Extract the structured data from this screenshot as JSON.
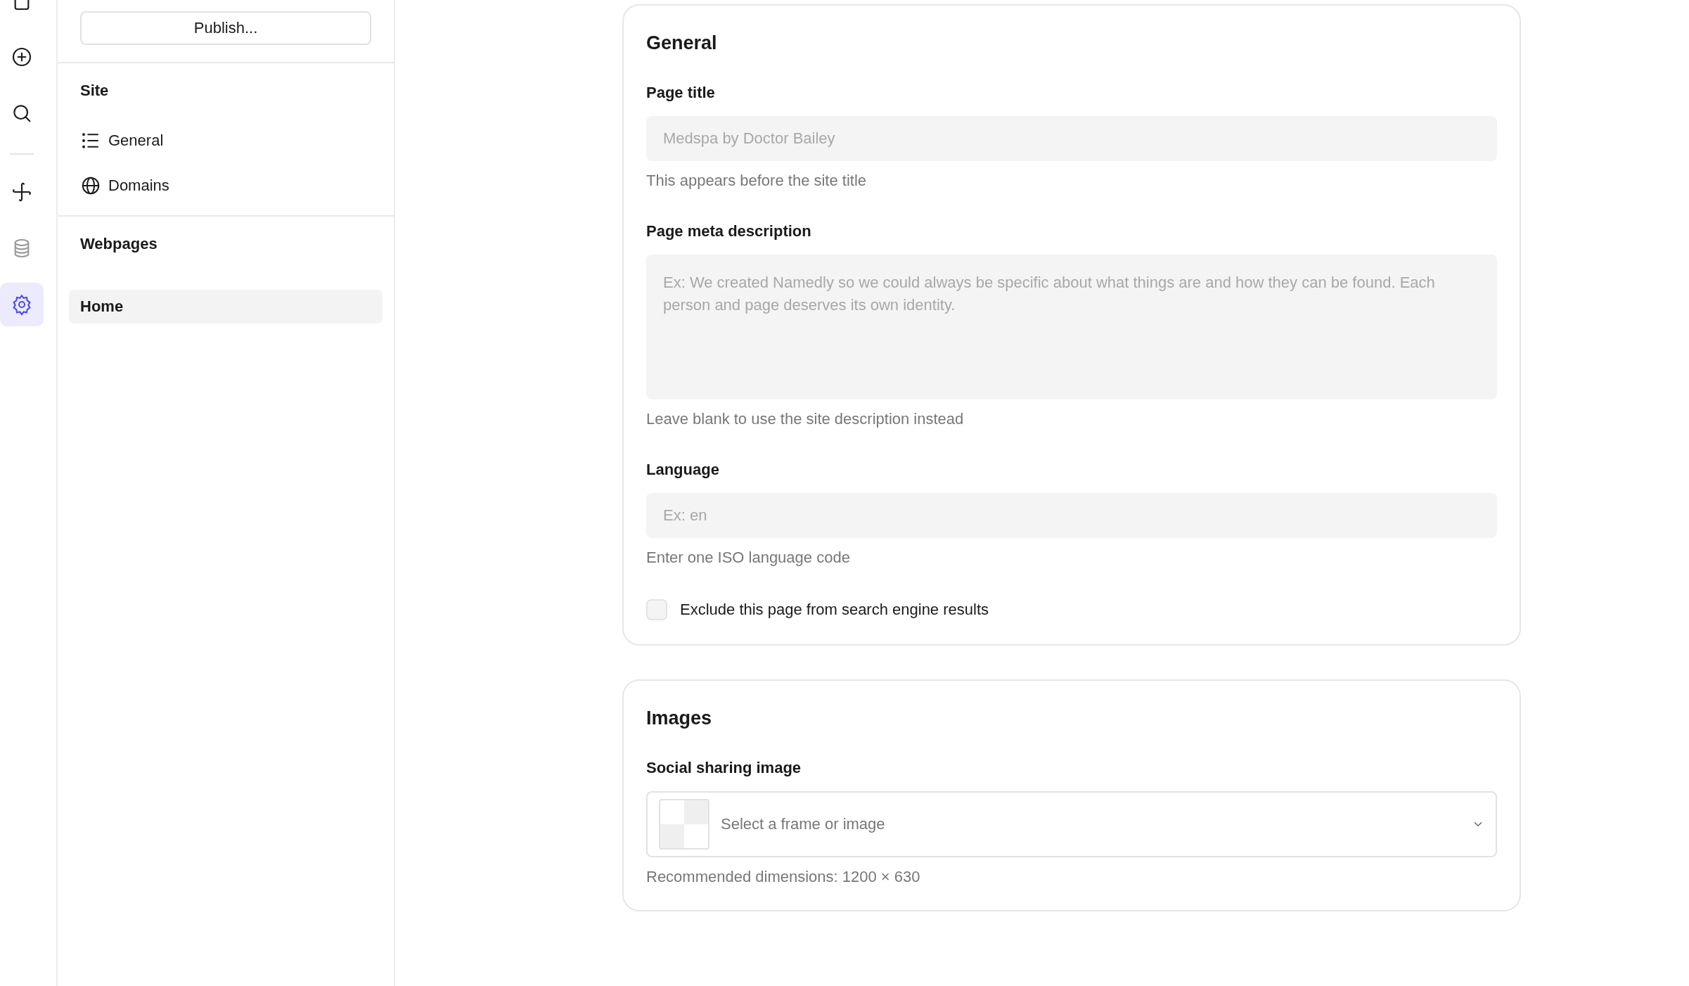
{
  "rail": {
    "groups": [
      {
        "items": [
          {
            "kind": "page",
            "selected": false
          },
          {
            "kind": "add",
            "selected": false
          },
          {
            "kind": "search",
            "selected": false
          }
        ]
      },
      {
        "items": [
          {
            "kind": "pinwheel",
            "selected": false
          },
          {
            "kind": "database",
            "selected": false
          },
          {
            "kind": "settings",
            "selected": true
          }
        ]
      }
    ]
  },
  "sidebar": {
    "publish_button": "Publish...",
    "sections": [
      {
        "title": "Site",
        "items": [
          {
            "label": "General",
            "kind": "list",
            "selected": false
          },
          {
            "label": "Domains",
            "kind": "globe",
            "selected": false
          }
        ]
      },
      {
        "title": "Webpages",
        "items": [
          {
            "label": "Home",
            "selected": true
          }
        ]
      }
    ]
  },
  "cards": [
    {
      "title": "General",
      "fields": [
        {
          "kind": "input",
          "label": "Page title",
          "placeholder": "Medspa by Doctor Bailey",
          "help": "This appears before the site title"
        },
        {
          "kind": "textarea",
          "label": "Page meta description",
          "placeholder": "Ex: We created Namedly so we could always be specific about what things are and how they can be found. Each person and page deserves its own identity.",
          "help": "Leave blank to use the site description instead"
        },
        {
          "kind": "input",
          "label": "Language",
          "placeholder": "Ex: en",
          "help": "Enter one ISO language code"
        },
        {
          "kind": "checkbox",
          "label": "Exclude this page from search engine results",
          "checked": false
        }
      ]
    },
    {
      "title": "Images",
      "fields": [
        {
          "kind": "select",
          "label": "Social sharing image",
          "placeholder": "Select a frame or image",
          "help": "Recommended dimensions: 1200 × 630"
        }
      ]
    }
  ]
}
